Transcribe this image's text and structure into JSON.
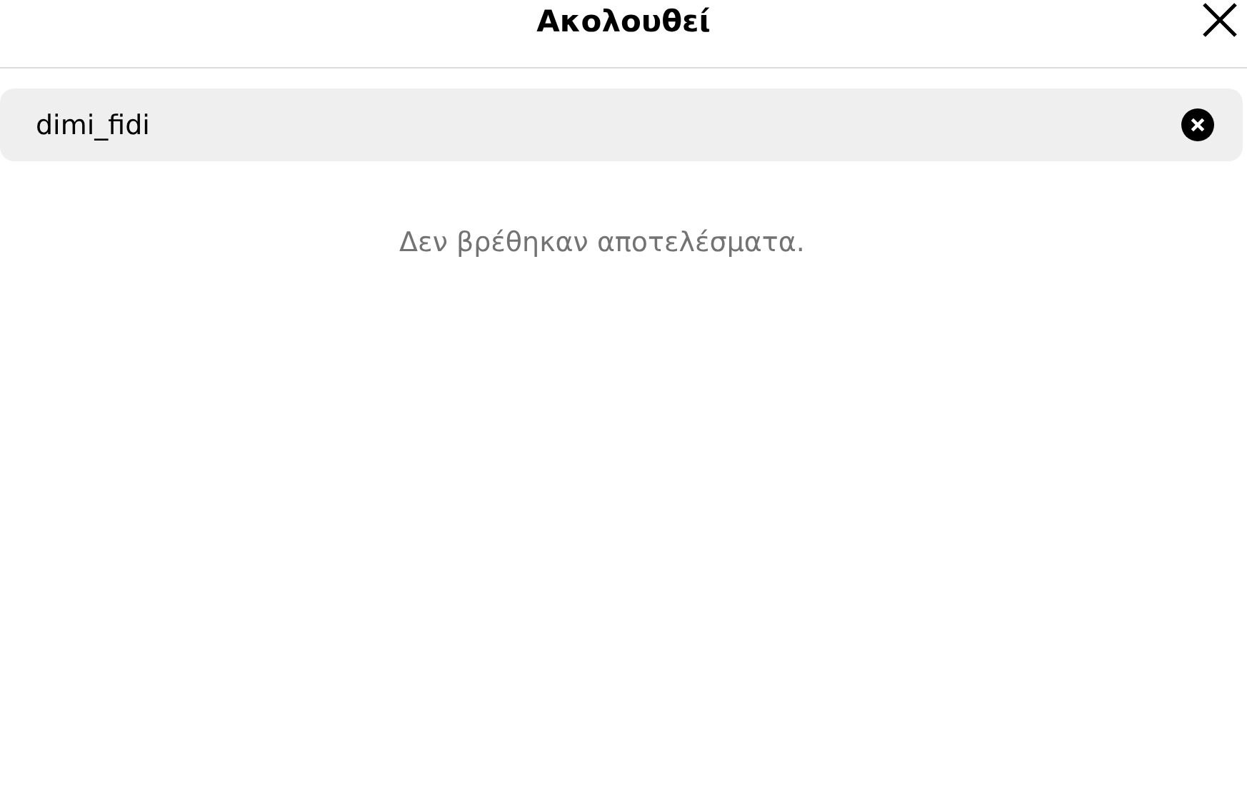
{
  "header": {
    "title": "Ακολουθεί"
  },
  "search": {
    "value": "dimi_fidi"
  },
  "empty_message": "Δεν βρέθηκαν αποτελέσματα."
}
